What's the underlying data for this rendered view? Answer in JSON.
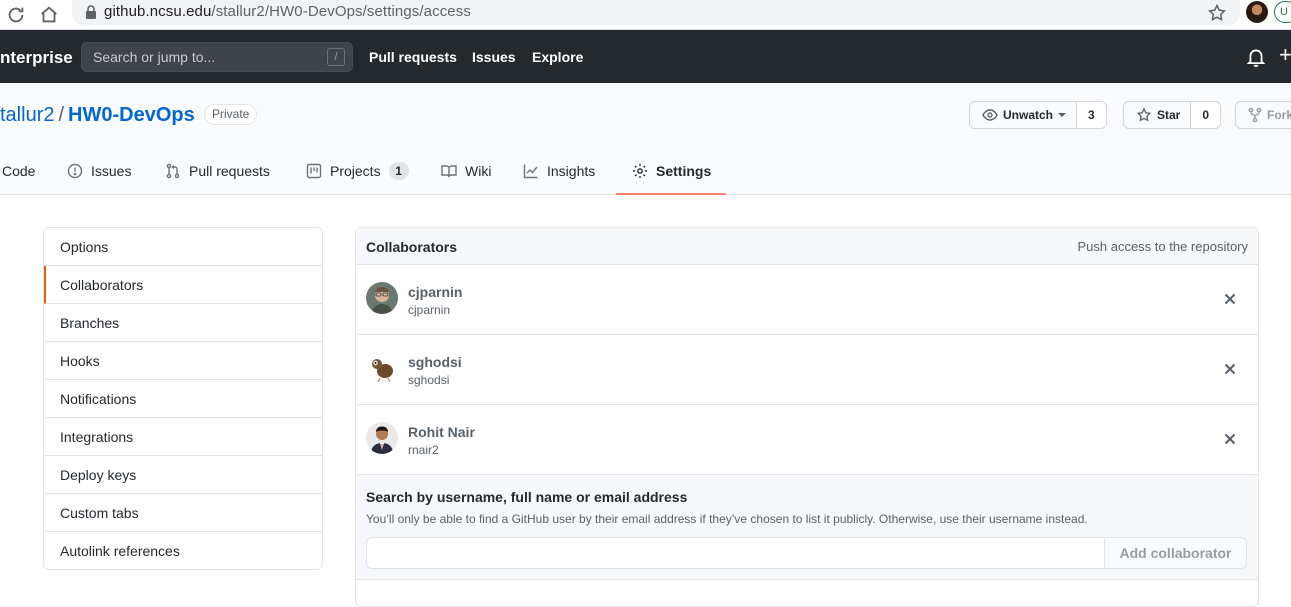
{
  "browser": {
    "url_host": "github.ncsu.edu",
    "url_path": "/stallur2/HW0-DevOps/settings/access",
    "extension_badge": "U"
  },
  "header": {
    "brand": "nterprise",
    "search_placeholder": "Search or jump to...",
    "search_shortcut": "/",
    "nav": [
      "Pull requests",
      "Issues",
      "Explore"
    ],
    "plus": "+"
  },
  "repo": {
    "owner": "tallur2",
    "separator": "/",
    "name": "HW0-DevOps",
    "visibility": "Private",
    "watch_label": "Unwatch",
    "watch_count": "3",
    "star_label": "Star",
    "star_count": "0",
    "fork_label": "Fork"
  },
  "tabs": [
    {
      "label": "Code"
    },
    {
      "label": "Issues"
    },
    {
      "label": "Pull requests"
    },
    {
      "label": "Projects",
      "count": "1"
    },
    {
      "label": "Wiki"
    },
    {
      "label": "Insights"
    },
    {
      "label": "Settings"
    }
  ],
  "sidebar": {
    "items": [
      "Options",
      "Collaborators",
      "Branches",
      "Hooks",
      "Notifications",
      "Integrations",
      "Deploy keys",
      "Custom tabs",
      "Autolink references"
    ],
    "selected": "Collaborators"
  },
  "collaborators": {
    "title": "Collaborators",
    "subtitle": "Push access to the repository",
    "list": [
      {
        "name": "cjparnin",
        "login": "cjparnin"
      },
      {
        "name": "sghodsi",
        "login": "sghodsi"
      },
      {
        "name": "Rohit Nair",
        "login": "rnair2"
      }
    ],
    "search_heading": "Search by username, full name or email address",
    "search_note": "You’ll only be able to find a GitHub user by their email address if they’ve chosen to list it publicly. Otherwise, use their username instead.",
    "input_value": "",
    "add_button": "Add collaborator"
  },
  "colors": {
    "header_bg": "#24292e",
    "link": "#0366d6",
    "active_tab_underline": "#f9826c",
    "selected_menu_border": "#e36209"
  }
}
